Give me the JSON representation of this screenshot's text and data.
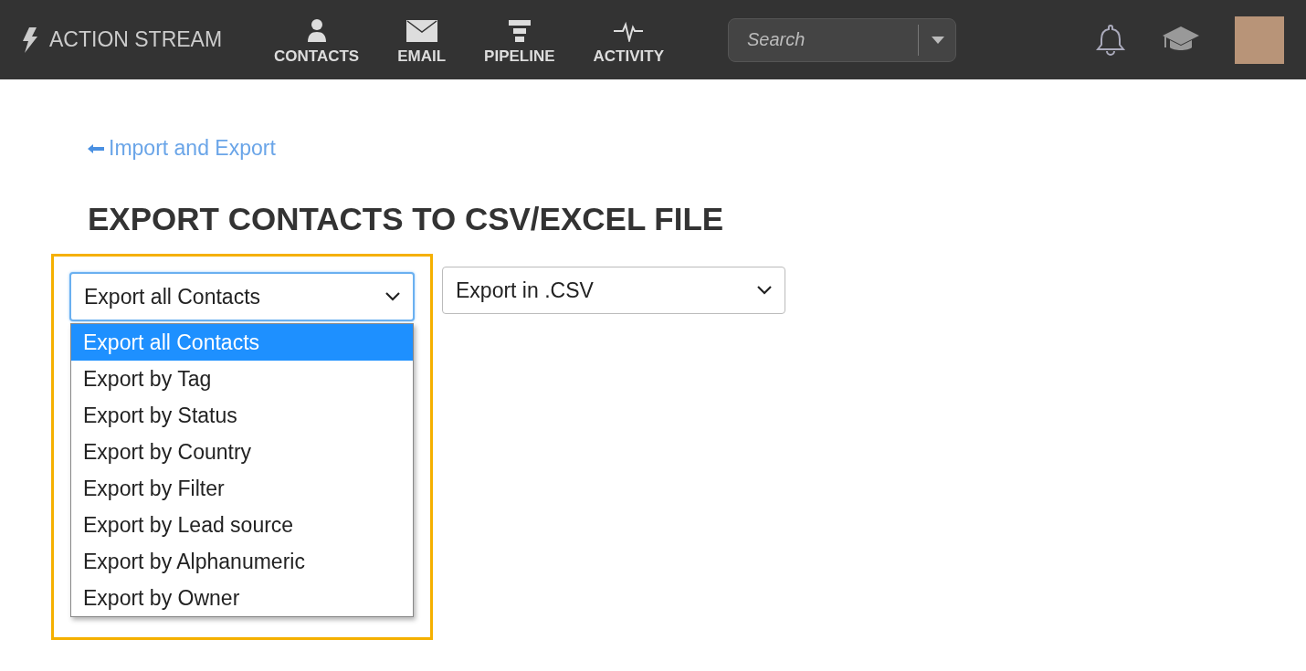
{
  "brand": "ACTION STREAM",
  "nav": [
    {
      "label": "CONTACTS",
      "kind": "person"
    },
    {
      "label": "EMAIL",
      "kind": "envelope"
    },
    {
      "label": "PIPELINE",
      "kind": "funnel"
    },
    {
      "label": "ACTIVITY",
      "kind": "pulse"
    }
  ],
  "search": {
    "placeholder": "Search"
  },
  "back_link": "Import and Export",
  "heading": "EXPORT CONTACTS TO CSV/EXCEL FILE",
  "contact_select": {
    "value": "Export all Contacts",
    "expanded": true,
    "options": [
      {
        "label": "Export all Contacts",
        "selected": true
      },
      {
        "label": "Export by Tag",
        "selected": false
      },
      {
        "label": "Export by Status",
        "selected": false
      },
      {
        "label": "Export by Country",
        "selected": false
      },
      {
        "label": "Export by Filter",
        "selected": false
      },
      {
        "label": "Export by Lead source",
        "selected": false
      },
      {
        "label": "Export by Alphanumeric",
        "selected": false
      },
      {
        "label": "Export by Owner",
        "selected": false
      }
    ]
  },
  "format_select": {
    "value": "Export in .CSV"
  }
}
